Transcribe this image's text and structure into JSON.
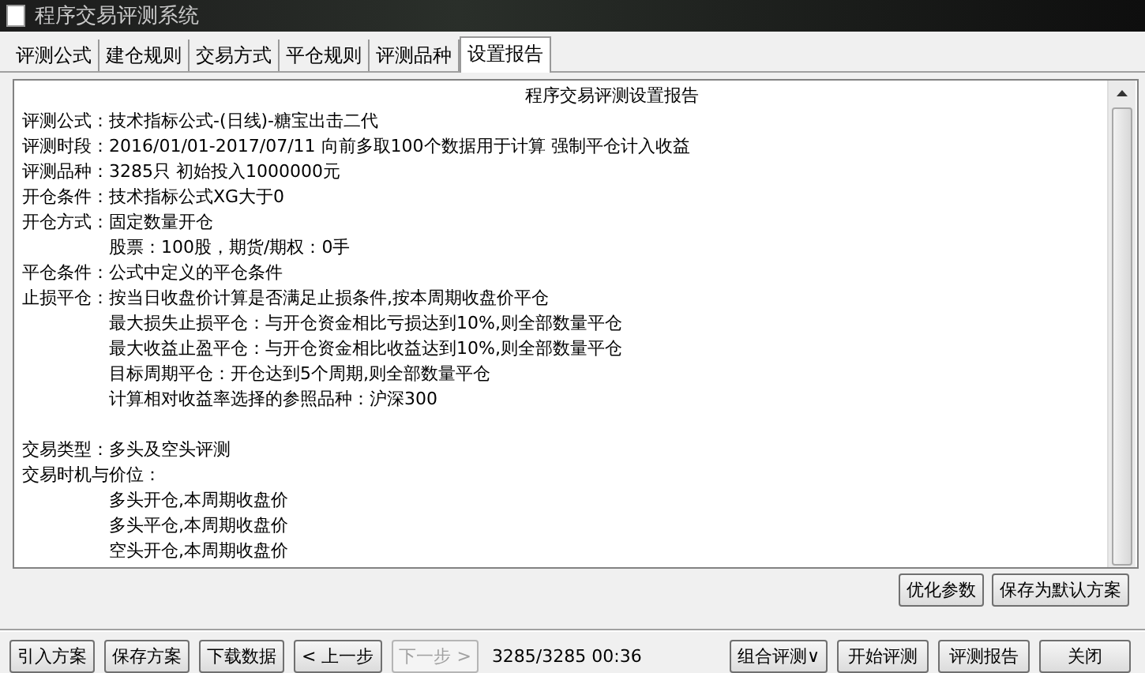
{
  "window": {
    "title": "程序交易评测系统"
  },
  "tabs": [
    {
      "label": "评测公式",
      "selected": false
    },
    {
      "label": "建仓规则",
      "selected": false
    },
    {
      "label": "交易方式",
      "selected": false
    },
    {
      "label": "平仓规则",
      "selected": false
    },
    {
      "label": "评测品种",
      "selected": false
    },
    {
      "label": "设置报告",
      "selected": true
    }
  ],
  "report": {
    "title": "程序交易评测设置报告",
    "lines": [
      {
        "kind": "field",
        "label": "评测公式：",
        "value": "技术指标公式-(日线)-糖宝出击二代"
      },
      {
        "kind": "field",
        "label": "评测时段：",
        "value": "2016/01/01-2017/07/11 向前多取100个数据用于计算 强制平仓计入收益"
      },
      {
        "kind": "field",
        "label": "评测品种：",
        "value": "3285只 初始投入1000000元"
      },
      {
        "kind": "field",
        "label": "开仓条件：",
        "value": "技术指标公式XG大于0"
      },
      {
        "kind": "field",
        "label": "开仓方式：",
        "value": "固定数量开仓"
      },
      {
        "kind": "sub",
        "value": "股票：100股，期货/期权：0手"
      },
      {
        "kind": "field",
        "label": "平仓条件：",
        "value": "公式中定义的平仓条件"
      },
      {
        "kind": "field",
        "label": "止损平仓：",
        "value": "按当日收盘价计算是否满足止损条件,按本周期收盘价平仓"
      },
      {
        "kind": "sub",
        "value": "最大损失止损平仓：与开仓资金相比亏损达到10%,则全部数量平仓"
      },
      {
        "kind": "sub",
        "value": "最大收益止盈平仓：与开仓资金相比收益达到10%,则全部数量平仓"
      },
      {
        "kind": "sub",
        "value": "目标周期平仓：开仓达到5个周期,则全部数量平仓"
      },
      {
        "kind": "sub",
        "value": "计算相对收益率选择的参照品种：沪深300"
      },
      {
        "kind": "blank"
      },
      {
        "kind": "field",
        "label": "交易类型：",
        "value": "多头及空头评测"
      },
      {
        "kind": "field",
        "label": "交易时机与价位："
      },
      {
        "kind": "sub",
        "value": "多头开仓,本周期收盘价"
      },
      {
        "kind": "sub",
        "value": "多头平仓,本周期收盘价"
      },
      {
        "kind": "sub",
        "value": "空头开仓,本周期收盘价"
      }
    ]
  },
  "panel_buttons": [
    {
      "label": "优化参数",
      "disabled": false
    },
    {
      "label": "保存为默认方案",
      "disabled": false
    }
  ],
  "bottom_left_buttons": [
    {
      "label": "引入方案",
      "disabled": false
    },
    {
      "label": "保存方案",
      "disabled": false
    },
    {
      "label": "下载数据",
      "disabled": false
    },
    {
      "label": "< 上一步",
      "disabled": false
    },
    {
      "label": "下一步 >",
      "disabled": true
    }
  ],
  "status": "3285/3285 00:36",
  "bottom_right_buttons": [
    {
      "label": "组合评测∨",
      "disabled": false
    },
    {
      "label": "开始评测",
      "disabled": false
    },
    {
      "label": "评测报告",
      "disabled": false
    },
    {
      "label": "关闭",
      "disabled": false
    }
  ]
}
